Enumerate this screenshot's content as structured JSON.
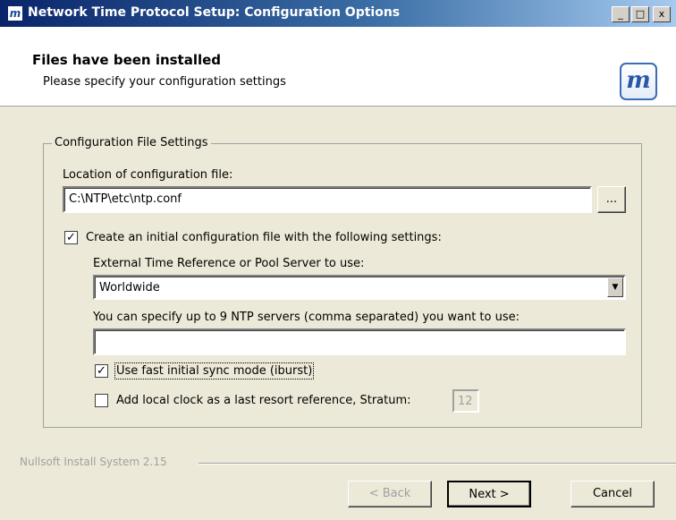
{
  "window": {
    "title": "Network Time Protocol Setup: Configuration Options",
    "app_icon": "nsis-m-icon",
    "controls": [
      "_",
      "□",
      "x"
    ]
  },
  "header": {
    "title": "Files have been installed",
    "subtitle": "Please specify your configuration settings",
    "logo_text": "m"
  },
  "group": {
    "legend": "Configuration File Settings",
    "location_label": "Location of configuration file:",
    "location_value": "C:\\NTP\\etc\\ntp.conf",
    "browse_label": "...",
    "create_checkbox": {
      "checked": true,
      "mark": "✓",
      "label": "Create an initial configuration file with the following settings:"
    },
    "server_label": "External Time Reference or Pool Server to use:",
    "server_selected": "Worldwide",
    "dropdown_arrow": "▼",
    "ntp_servers_label": "You can specify up to 9 NTP servers (comma separated) you want to use:",
    "ntp_servers_value": "",
    "iburst_checkbox": {
      "checked": true,
      "mark": "✓",
      "label": "Use fast initial sync mode (iburst)"
    },
    "local_clock_checkbox": {
      "checked": false,
      "mark": "",
      "label": "Add local clock as a last resort reference, Stratum:"
    },
    "stratum_value": "12"
  },
  "footer": {
    "branding": "Nullsoft Install System 2.15",
    "back_label": "< Back",
    "next_label": "Next >",
    "cancel_label": "Cancel"
  }
}
